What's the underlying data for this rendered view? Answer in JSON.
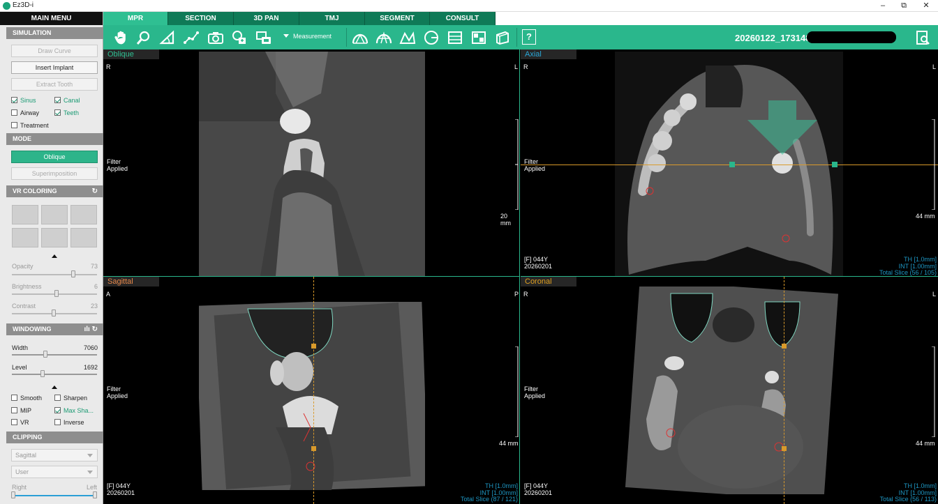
{
  "window": {
    "title": "Ez3D-i",
    "minimize": "–",
    "maximize": "⧉",
    "close": "✕"
  },
  "sidebar": {
    "main_menu": "MAIN MENU",
    "simulation": {
      "header": "SIMULATION",
      "draw_curve": "Draw Curve",
      "insert_implant": "Insert Implant",
      "extract_tooth": "Extract Tooth",
      "checks": [
        {
          "label": "Sinus",
          "checked": true
        },
        {
          "label": "Canal",
          "checked": true
        },
        {
          "label": "Airway",
          "checked": false
        },
        {
          "label": "Teeth",
          "checked": true
        },
        {
          "label": "Treatment",
          "checked": false
        }
      ]
    },
    "mode": {
      "header": "MODE",
      "oblique": "Oblique",
      "superimposition": "Superimposition"
    },
    "vr_coloring": {
      "header": "VR COLORING",
      "opacity_label": "Opacity",
      "opacity_value": "73",
      "brightness_label": "Brightness",
      "brightness_value": "6",
      "contrast_label": "Contrast",
      "contrast_value": "23"
    },
    "windowing": {
      "header": "WINDOWING",
      "width_label": "Width",
      "width_value": "7060",
      "level_label": "Level",
      "level_value": "1692",
      "checks": [
        {
          "label": "Smooth",
          "checked": false
        },
        {
          "label": "Sharpen",
          "checked": false
        },
        {
          "label": "MIP",
          "checked": false
        },
        {
          "label": "Max Sha...",
          "checked": true
        },
        {
          "label": "VR",
          "checked": false
        },
        {
          "label": "Inverse",
          "checked": false
        }
      ]
    },
    "clipping": {
      "header": "CLIPPING",
      "plane_select": "Sagittal",
      "mode_select": "User",
      "right_label": "Right",
      "left_label": "Left"
    }
  },
  "tabs": [
    "MPR",
    "SECTION",
    "3D PAN",
    "TMJ",
    "SEGMENT",
    "CONSULT"
  ],
  "active_tab": "MPR",
  "toolbar": {
    "measurement_label": "Measurement",
    "help_label": "?",
    "patient_id": "20260122_173148"
  },
  "panes": {
    "oblique": {
      "label": "Oblique",
      "label_color": "#2fbf92",
      "orient_left": "R",
      "orient_right": "L",
      "filter": "Filter\nApplied",
      "scale": "20 mm"
    },
    "axial": {
      "label": "Axial",
      "label_color": "#2aa7d8",
      "orient_left": "R",
      "orient_right": "L",
      "filter": "Filter\nApplied",
      "scale": "44 mm",
      "patient": "[F] 044Y",
      "date": "20260201",
      "th": "TH [1.0mm]",
      "int": "INT [1.00mm]",
      "slice": "Total Slice (56 / 105)"
    },
    "sagittal": {
      "label": "Sagittal",
      "label_color": "#e8884a",
      "orient_left": "A",
      "orient_right": "P",
      "filter": "Filter\nApplied",
      "scale": "44 mm",
      "patient": "[F] 044Y",
      "date": "20260201",
      "th": "TH [1.0mm]",
      "int": "INT [1.00mm]",
      "slice": "Total Slice (87 / 121)"
    },
    "coronal": {
      "label": "Coronal",
      "label_color": "#e0a020",
      "orient_left": "R",
      "orient_right": "L",
      "filter": "Filter\nApplied",
      "scale": "44 mm",
      "patient": "[F] 044Y",
      "date": "20260201",
      "th": "TH [1.0mm]",
      "int": "INT [1.00mm]",
      "slice": "Total Slice (56 / 113)"
    }
  },
  "colors": {
    "accent": "#2ab78c",
    "tab_dark": "#0f7a57",
    "crosshair": "#d99a2b"
  }
}
